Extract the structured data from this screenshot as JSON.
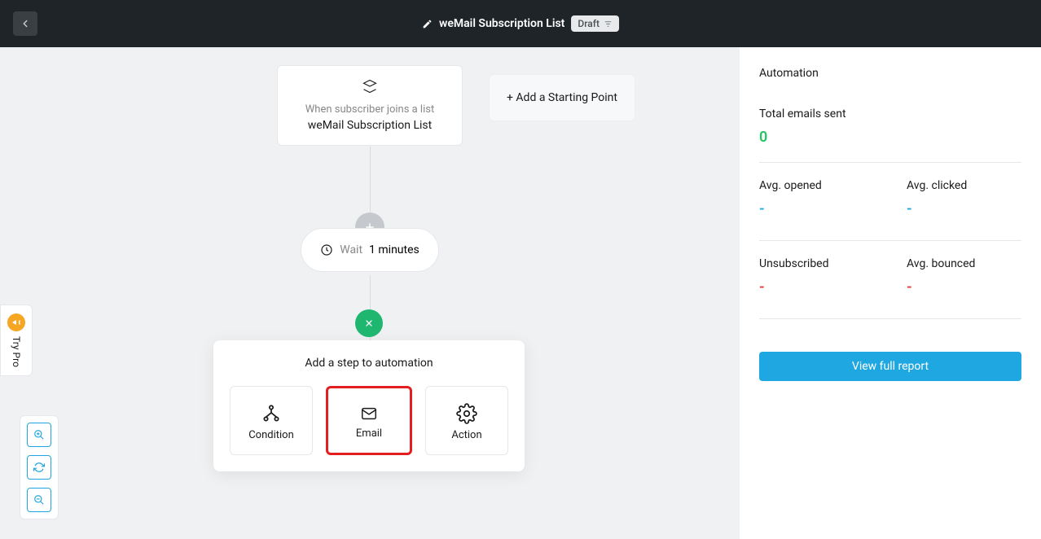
{
  "header": {
    "title": "weMail Subscription List",
    "status": "Draft"
  },
  "flow": {
    "trigger": {
      "description": "When subscriber joins a list",
      "list_name": "weMail Subscription List"
    },
    "add_starting_point_label": "+ Add a Starting Point",
    "wait": {
      "label": "Wait",
      "duration": "1 minutes"
    },
    "step_panel": {
      "title": "Add a step to automation",
      "options": [
        {
          "label": "Condition",
          "icon": "fork-icon"
        },
        {
          "label": "Email",
          "icon": "mail-icon"
        },
        {
          "label": "Action",
          "icon": "gear-icon"
        }
      ]
    }
  },
  "sidebar": {
    "title": "Automation",
    "stats": {
      "total_emails_label": "Total emails sent",
      "total_emails_value": "0",
      "avg_opened_label": "Avg. opened",
      "avg_opened_value": "-",
      "avg_clicked_label": "Avg. clicked",
      "avg_clicked_value": "-",
      "unsubscribed_label": "Unsubscribed",
      "unsubscribed_value": "-",
      "avg_bounced_label": "Avg. bounced",
      "avg_bounced_value": "-"
    },
    "report_button": "View full report"
  },
  "try_pro_label": "Try Pro"
}
